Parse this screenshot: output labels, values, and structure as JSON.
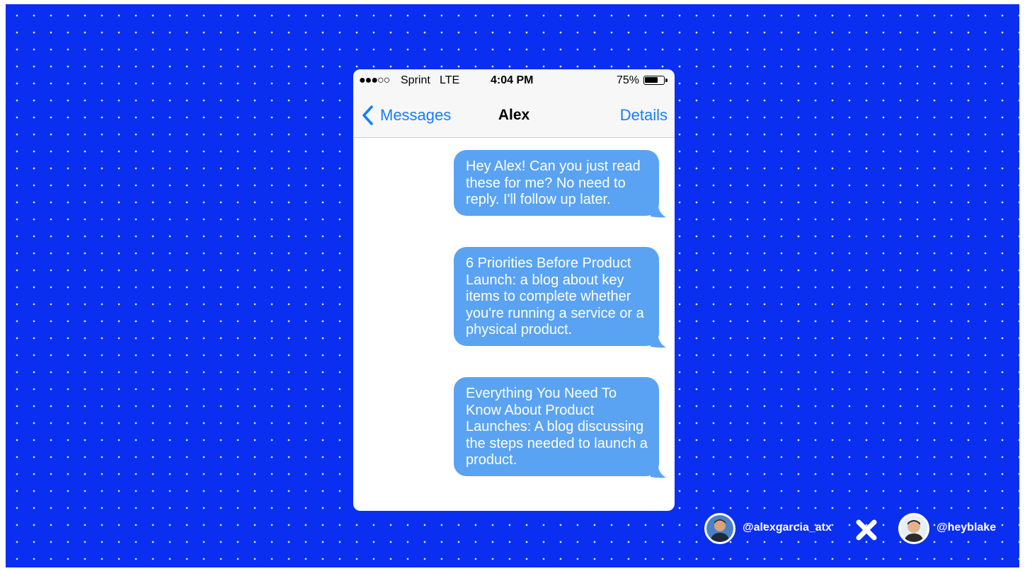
{
  "status_bar": {
    "signal": "●●●○○",
    "carrier": "Sprint",
    "network": "LTE",
    "time": "4:04 PM",
    "battery_percent": "75%",
    "battery_level": 0.75
  },
  "nav": {
    "back_label": "Messages",
    "title": "Alex",
    "details_label": "Details"
  },
  "messages": [
    {
      "text": "Hey Alex! Can you just read these for me? No need to reply. I'll follow up later."
    },
    {
      "text": "6 Priorities Before Product Launch: a blog about key items to complete whether you're running a service or a physical product."
    },
    {
      "text": "Everything You Need To Know About Product Launches: A blog discussing the steps needed to launch a product."
    }
  ],
  "credits": {
    "left_handle": "@alexgarcia_atx",
    "separator_icon": "x-icon",
    "right_handle": "@heyblake"
  },
  "colors": {
    "background": "#0a2ff0",
    "bubble": "#5aa3f2",
    "ios_blue": "#157efb"
  }
}
